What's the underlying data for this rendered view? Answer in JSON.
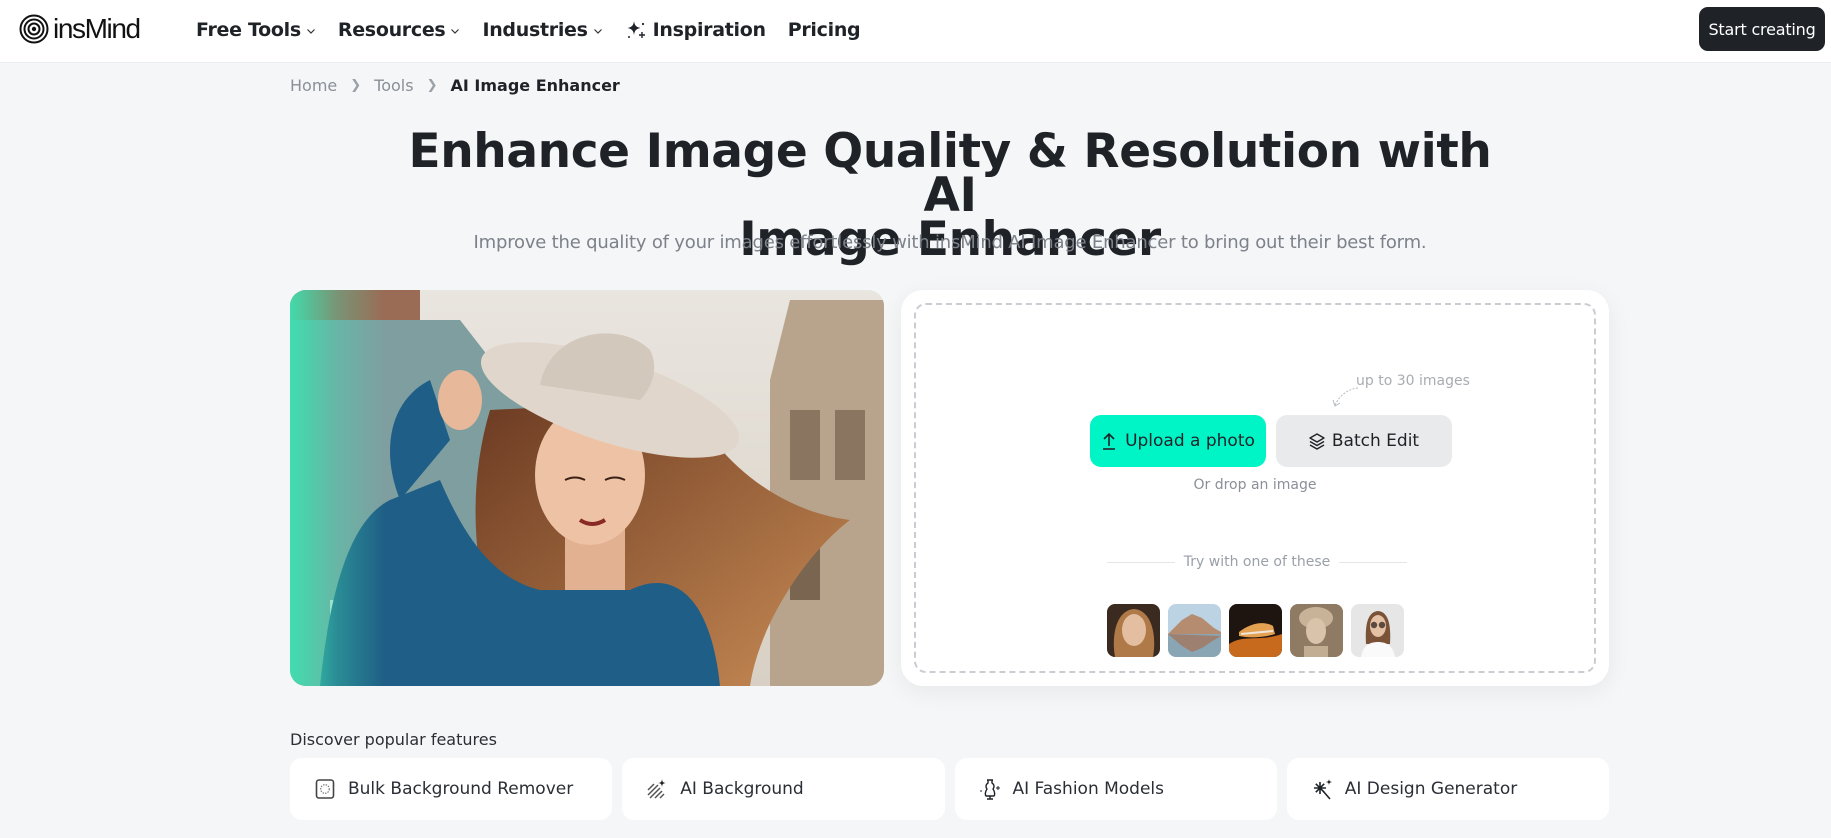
{
  "header": {
    "logo_text": "insMind",
    "nav": [
      {
        "label": "Free Tools",
        "icon": "chevron-down-icon"
      },
      {
        "label": "Resources",
        "icon": "chevron-down-icon"
      },
      {
        "label": "Industries",
        "icon": "chevron-down-icon"
      },
      {
        "label": "Inspiration",
        "icon": "sparkle-icon"
      },
      {
        "label": "Pricing"
      }
    ],
    "cta_label": "Start creating"
  },
  "breadcrumb": [
    {
      "label": "Home"
    },
    {
      "label": "Tools"
    },
    {
      "label": "AI Image Enhancer"
    }
  ],
  "hero": {
    "title_line1": "Enhance Image Quality & Resolution with AI",
    "title_line2": "Image Enhancer",
    "subtitle": "Improve the quality of your images effortlessly with insMind AI Image Enhancer to bring out their best form."
  },
  "upload": {
    "upload_label": "Upload a photo",
    "batch_label": "Batch Edit",
    "batch_note": "up to 30 images",
    "drop_text": "Or drop an image",
    "try_label": "Try with one of these",
    "samples": [
      {
        "name": "portrait-woman-wavy-hair"
      },
      {
        "name": "mountain-lake-reflection"
      },
      {
        "name": "sneaker-on-orange"
      },
      {
        "name": "vintage-portrait"
      },
      {
        "name": "woman-sunglasses"
      }
    ]
  },
  "features": {
    "heading": "Discover popular features",
    "items": [
      {
        "label": "Bulk Background Remover",
        "icon": "bulk-bg-remover-icon"
      },
      {
        "label": "AI Background",
        "icon": "ai-background-icon"
      },
      {
        "label": "AI Fashion Models",
        "icon": "fashion-model-icon"
      },
      {
        "label": "AI Design Generator",
        "icon": "design-generator-icon"
      }
    ]
  },
  "colors": {
    "accent": "#00f5c6",
    "dark_button": "#1f2328",
    "page_bg": "#f5f6f7"
  }
}
